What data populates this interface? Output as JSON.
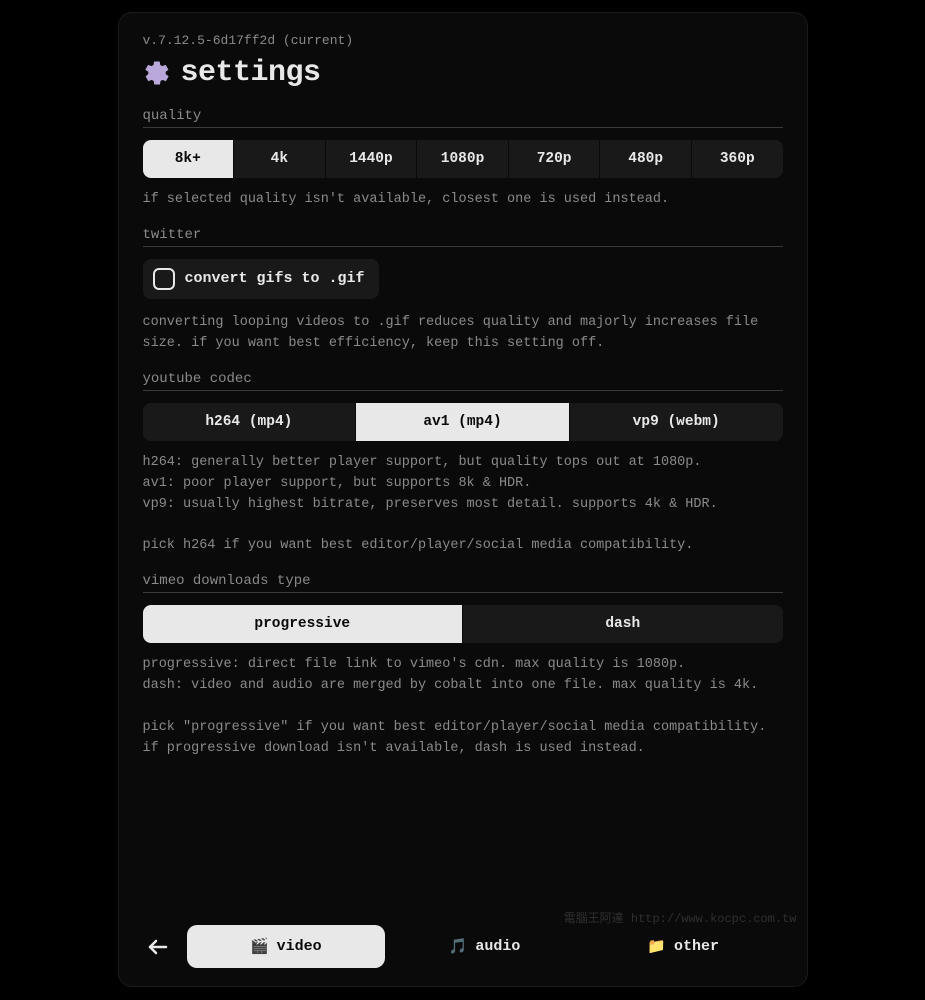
{
  "version": "v.7.12.5-6d17ff2d (current)",
  "title": "settings",
  "sections": {
    "quality": {
      "label": "quality",
      "options": [
        "8k+",
        "4k",
        "1440p",
        "1080p",
        "720p",
        "480p",
        "360p"
      ],
      "selected": "8k+",
      "help": "if selected quality isn't available, closest one is used instead."
    },
    "twitter": {
      "label": "twitter",
      "checkbox_label": "convert gifs to .gif",
      "checked": false,
      "help": "converting looping videos to .gif reduces quality and majorly increases file size. if you want best efficiency, keep this setting off."
    },
    "codec": {
      "label": "youtube codec",
      "options": [
        "h264 (mp4)",
        "av1 (mp4)",
        "vp9 (webm)"
      ],
      "selected": "av1 (mp4)",
      "help": "h264: generally better player support, but quality tops out at 1080p.\nav1: poor player support, but supports 8k & HDR.\nvp9: usually highest bitrate, preserves most detail. supports 4k & HDR.\n\npick h264 if you want best editor/player/social media compatibility."
    },
    "vimeo": {
      "label": "vimeo downloads type",
      "options": [
        "progressive",
        "dash"
      ],
      "selected": "progressive",
      "help": "progressive: direct file link to vimeo's cdn. max quality is 1080p.\ndash: video and audio are merged by cobalt into one file. max quality is 4k.\n\npick \"progressive\" if you want best editor/player/social media compatibility. if progressive download isn't available, dash is used instead."
    }
  },
  "tabs": {
    "items": [
      {
        "id": "video",
        "label": "video",
        "icon": "🎬"
      },
      {
        "id": "audio",
        "label": "audio",
        "icon": "🎵"
      },
      {
        "id": "other",
        "label": "other",
        "icon": "📁"
      }
    ],
    "selected": "video"
  },
  "watermark": "電腦王阿達\nhttp://www.kocpc.com.tw"
}
